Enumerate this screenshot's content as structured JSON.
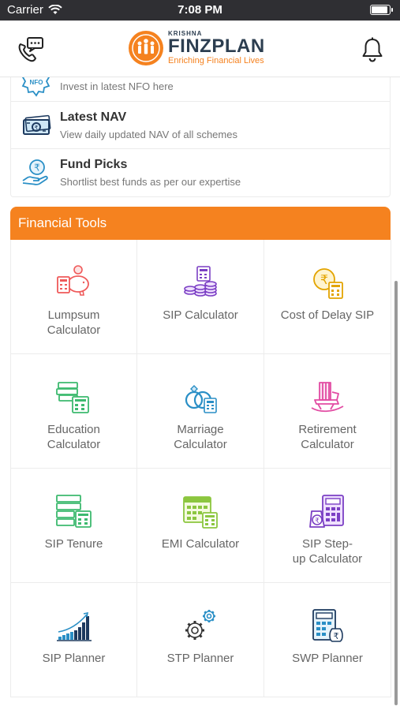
{
  "status_bar": {
    "carrier": "Carrier",
    "time": "7:08 PM"
  },
  "header": {
    "logo_small": "KRISHNA",
    "logo_brand": "FINZPLAN",
    "logo_tagline": "Enriching Financial Lives",
    "left_icon": "phone-chat-icon",
    "right_icon": "bell-icon"
  },
  "top_list": [
    {
      "title": "",
      "desc": "Invest in latest NFO here",
      "icon": "nfo-icon"
    },
    {
      "title": "Latest NAV",
      "desc": "View daily updated NAV of all schemes",
      "icon": "money-icon"
    },
    {
      "title": "Fund Picks",
      "desc": "Shortlist best funds as per our expertise",
      "icon": "rupee-hand-icon"
    }
  ],
  "tools": {
    "title": "Financial Tools",
    "items": [
      {
        "label": "Lumpsum\nCalculator",
        "icon": "piggy-bank-icon"
      },
      {
        "label": "SIP Calculator",
        "icon": "coins-icon"
      },
      {
        "label": "Cost of Delay SIP",
        "icon": "rupee-calculator-icon"
      },
      {
        "label": "Education\nCalculator",
        "icon": "education-icon"
      },
      {
        "label": "Marriage\nCalculator",
        "icon": "rings-icon"
      },
      {
        "label": "Retirement\nCalculator",
        "icon": "rocking-chair-icon"
      },
      {
        "label": "SIP Tenure",
        "icon": "tenure-icon"
      },
      {
        "label": "EMI Calculator",
        "icon": "calendar-icon"
      },
      {
        "label": "SIP Step-\nup Calculator",
        "icon": "stepup-icon"
      },
      {
        "label": "SIP Planner",
        "icon": "bar-growth-icon"
      },
      {
        "label": "STP Planner",
        "icon": "gears-icon"
      },
      {
        "label": "SWP Planner",
        "icon": "calculator-rupee-icon"
      }
    ]
  },
  "colors": {
    "accent": "#f5821f",
    "brand_dark": "#2c3e50",
    "status_bar": "#2f2f33"
  }
}
